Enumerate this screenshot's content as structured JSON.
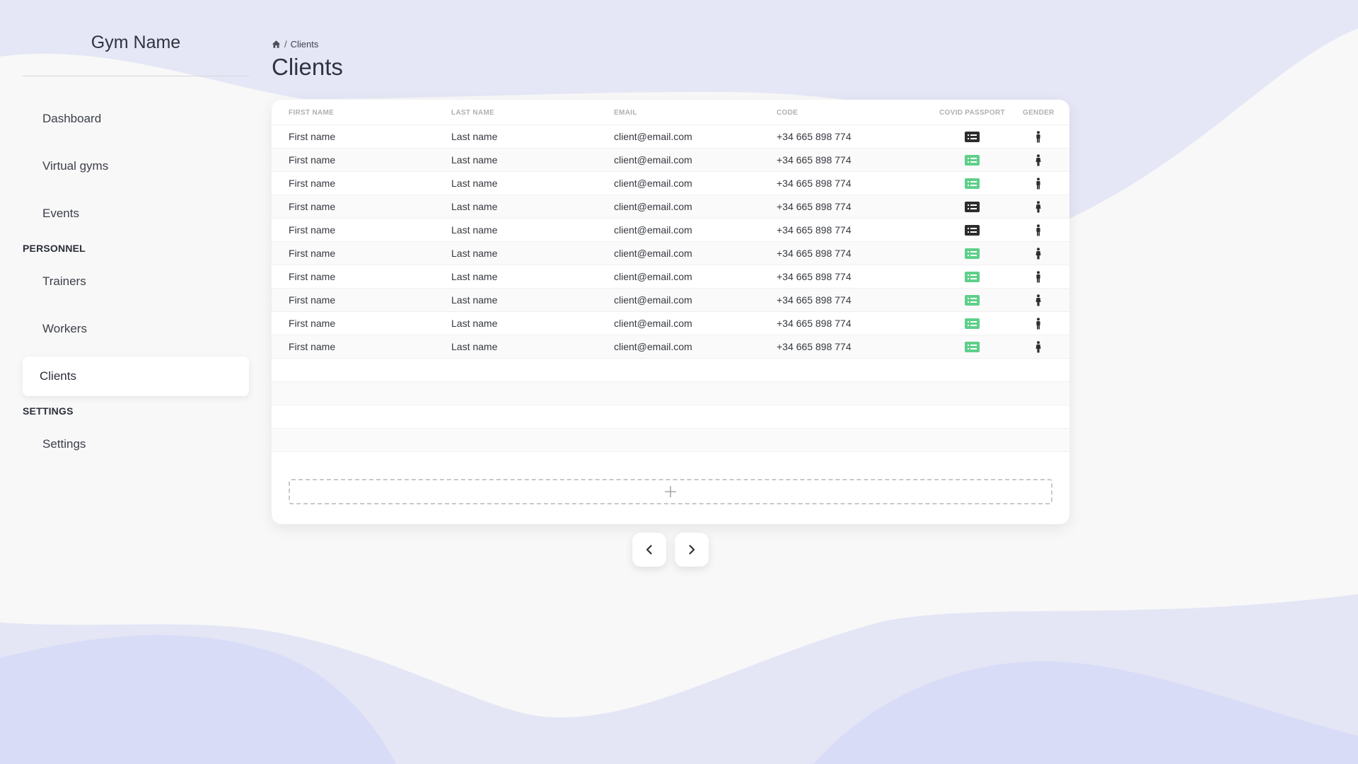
{
  "sidebar": {
    "brand": "Gym Name",
    "items": [
      {
        "label": "Dashboard"
      },
      {
        "label": "Virtual gyms"
      },
      {
        "label": "Events"
      }
    ],
    "sections": [
      {
        "label": "PERSONNEL",
        "items": [
          {
            "label": "Trainers"
          },
          {
            "label": "Workers"
          },
          {
            "label": "Clients",
            "active": true
          }
        ]
      },
      {
        "label": "SETTINGS",
        "items": [
          {
            "label": "Settings"
          }
        ]
      }
    ]
  },
  "breadcrumb": {
    "icon": "home-icon",
    "separator": "/",
    "current": "Clients"
  },
  "page": {
    "title": "Clients"
  },
  "table": {
    "headers": [
      "FIRST NAME",
      "LAST NAME",
      "EMAIL",
      "CODE",
      "COVID PASSPORT",
      "GENDER"
    ],
    "rows": [
      {
        "first_name": "First name",
        "last_name": "Last name",
        "email": "client@email.com",
        "code": "+34 665 898 774",
        "passport": "dark",
        "gender_icon": "male-icon"
      },
      {
        "first_name": "First name",
        "last_name": "Last name",
        "email": "client@email.com",
        "code": "+34 665 898 774",
        "passport": "green",
        "gender_icon": "female-icon"
      },
      {
        "first_name": "First name",
        "last_name": "Last name",
        "email": "client@email.com",
        "code": "+34 665 898 774",
        "passport": "green",
        "gender_icon": "male-icon"
      },
      {
        "first_name": "First name",
        "last_name": "Last name",
        "email": "client@email.com",
        "code": "+34 665 898 774",
        "passport": "dark",
        "gender_icon": "female-icon"
      },
      {
        "first_name": "First name",
        "last_name": "Last name",
        "email": "client@email.com",
        "code": "+34 665 898 774",
        "passport": "dark",
        "gender_icon": "male-icon"
      },
      {
        "first_name": "First name",
        "last_name": "Last name",
        "email": "client@email.com",
        "code": "+34 665 898 774",
        "passport": "green",
        "gender_icon": "female-icon"
      },
      {
        "first_name": "First name",
        "last_name": "Last name",
        "email": "client@email.com",
        "code": "+34 665 898 774",
        "passport": "green",
        "gender_icon": "male-icon"
      },
      {
        "first_name": "First name",
        "last_name": "Last name",
        "email": "client@email.com",
        "code": "+34 665 898 774",
        "passport": "green",
        "gender_icon": "female-icon"
      },
      {
        "first_name": "First name",
        "last_name": "Last name",
        "email": "client@email.com",
        "code": "+34 665 898 774",
        "passport": "green",
        "gender_icon": "male-icon"
      },
      {
        "first_name": "First name",
        "last_name": "Last name",
        "email": "client@email.com",
        "code": "+34 665 898 774",
        "passport": "green",
        "gender_icon": "female-icon"
      }
    ],
    "empty_rows": 4,
    "add_icon": "plus-icon"
  },
  "pagination": {
    "prev_icon": "chevron-left-icon",
    "next_icon": "chevron-right-icon"
  },
  "colors": {
    "passport_green": "#5fcf8a",
    "passport_dark": "#2d2d2d",
    "wave": "#e4e6f6",
    "wave_dark": "#d8dbf5"
  }
}
